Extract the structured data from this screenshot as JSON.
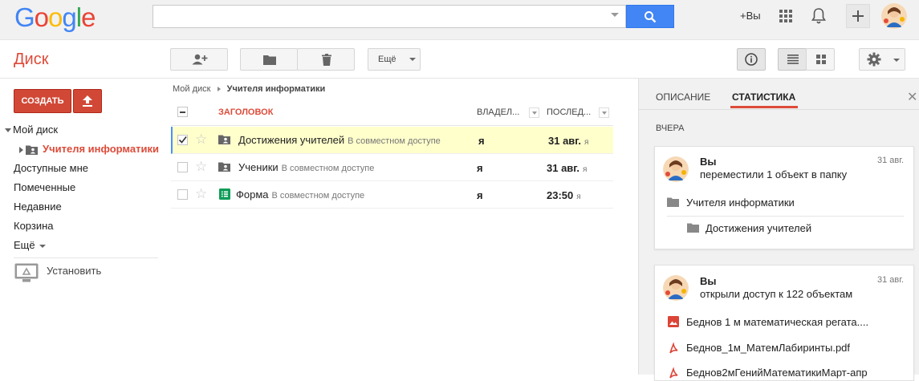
{
  "topbar": {
    "logo": "Google",
    "search_value": "",
    "plus_you": "+Вы"
  },
  "subbar": {
    "brand": "Диск",
    "more_label": "Ещё"
  },
  "sidebar": {
    "create_label": "СОЗДАТЬ",
    "items": [
      {
        "label": "Мой диск"
      },
      {
        "label": "Учителя информатики"
      },
      {
        "label": "Доступные мне"
      },
      {
        "label": "Помеченные"
      },
      {
        "label": "Недавние"
      },
      {
        "label": "Корзина"
      },
      {
        "label": "Ещё"
      }
    ],
    "install_label": "Установить"
  },
  "breadcrumb": {
    "root": "Мой диск",
    "current": "Учителя информатики"
  },
  "list": {
    "col_title": "ЗАГОЛОВОК",
    "col_owner": "ВЛАДЕЛ...",
    "col_modified": "ПОСЛЕД...",
    "rows": [
      {
        "name": "Достижения учителей",
        "shared": "В совместном доступе",
        "owner": "я",
        "modified": "31 авг.",
        "by": "я",
        "selected": true
      },
      {
        "name": "Ученики",
        "shared": "В совместном доступе",
        "owner": "я",
        "modified": "31 авг.",
        "by": "я",
        "selected": false
      },
      {
        "name": "Форма",
        "shared": "В совместном доступе",
        "owner": "я",
        "modified": "23:50",
        "by": "я",
        "selected": false
      }
    ]
  },
  "panel": {
    "tabs": [
      "ОПИСАНИЕ",
      "СТАТИСТИКА"
    ],
    "active_tab": "СТАТИСТИКА",
    "section": "ВЧЕРА",
    "cards": [
      {
        "who": "Вы",
        "what": "переместили 1 объект в папку",
        "date": "31 авг.",
        "items": [
          "Учителя информатики",
          "Достижения учителей"
        ]
      },
      {
        "who": "Вы",
        "what": "открыли доступ к 122 объектам",
        "date": "31 авг.",
        "items": [
          "Беднов 1 м математическая регата....",
          "Беднов_1м_МатемЛабиринты.pdf",
          "Беднов2мГенийМатематикиМарт-апр"
        ]
      }
    ]
  },
  "colors": {
    "brand_red": "#dd4b39",
    "create_red": "#d14836",
    "search_blue": "#4285f4",
    "selected_row": "#ffffcc"
  }
}
